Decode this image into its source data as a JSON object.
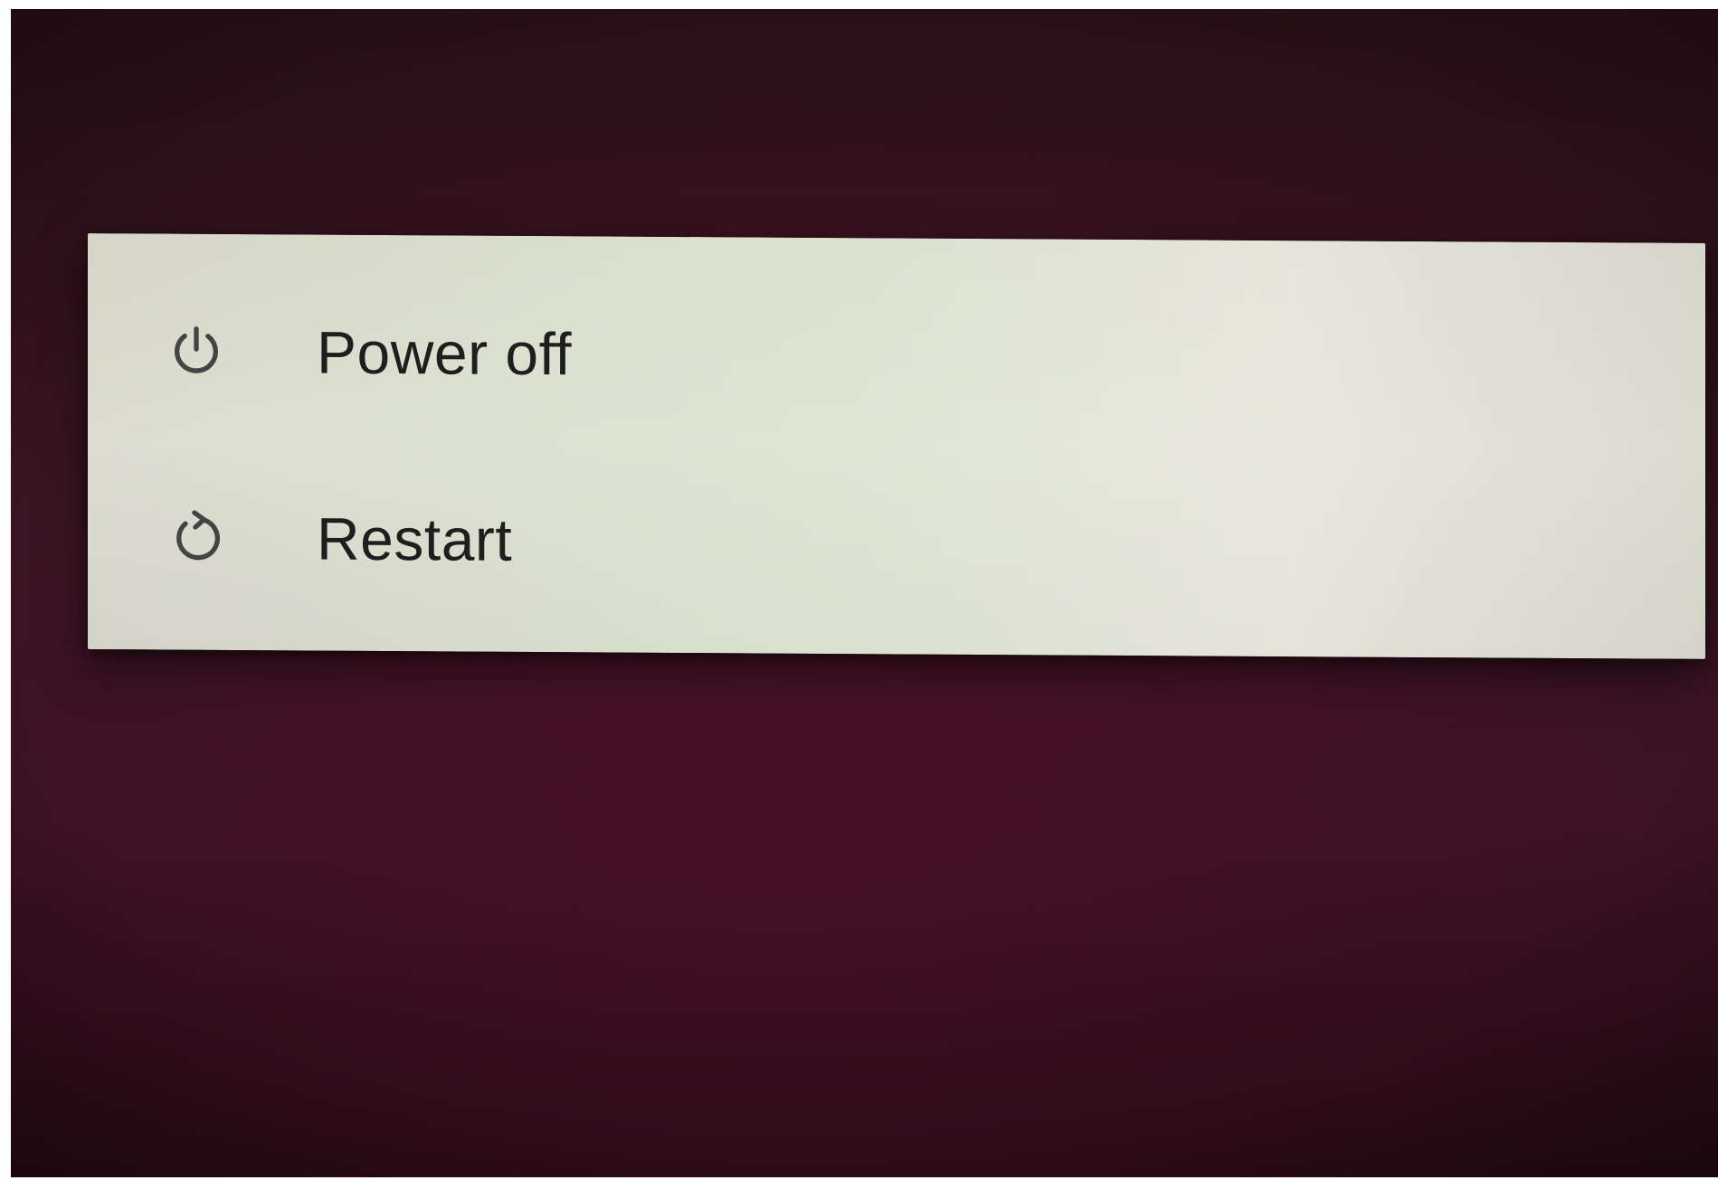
{
  "power_menu": {
    "items": [
      {
        "label": "Power off",
        "icon": "power-icon"
      },
      {
        "label": "Restart",
        "icon": "restart-icon"
      }
    ]
  },
  "colors": {
    "background": "#3a1422",
    "menu_surface": "#dcddd0",
    "text": "#1e1e1e",
    "icon": "#444444"
  }
}
